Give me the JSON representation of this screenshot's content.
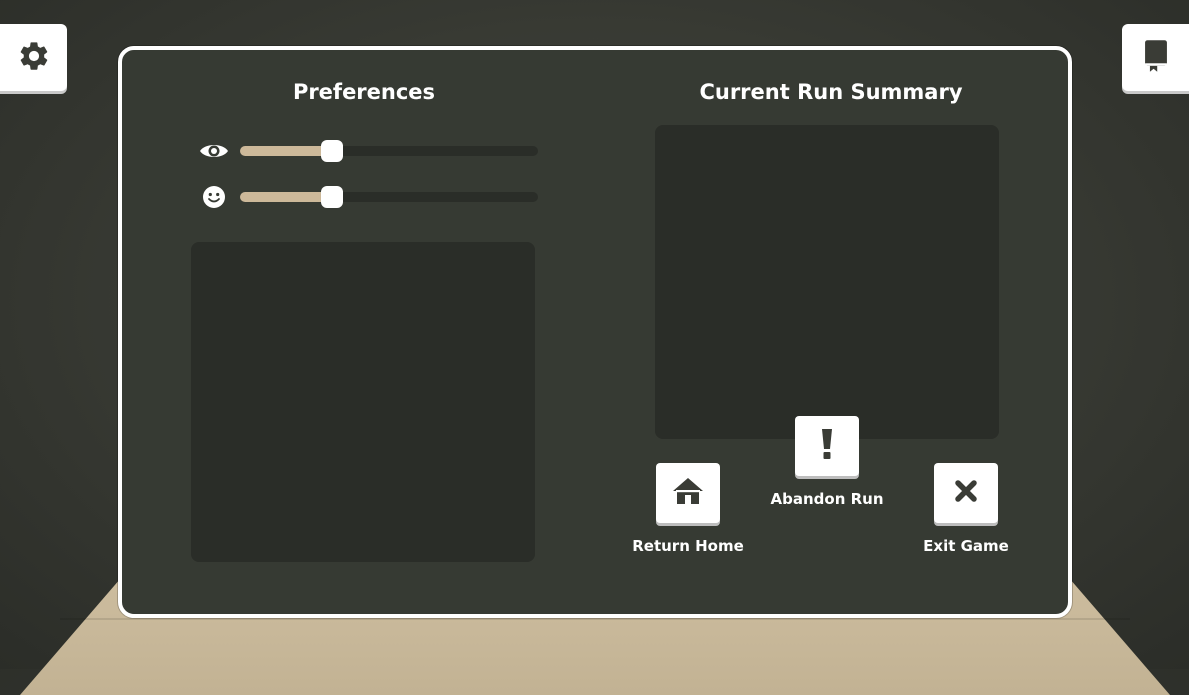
{
  "top_bar": {
    "settings_icon": "gear-icon",
    "journal_icon": "book-icon"
  },
  "preferences": {
    "title": "Preferences",
    "sliders": [
      {
        "icon": "eye-icon",
        "value": 0.31
      },
      {
        "icon": "smiley-icon",
        "value": 0.31
      }
    ]
  },
  "run_summary": {
    "title": "Current Run Summary"
  },
  "actions": {
    "return_home": {
      "label": "Return Home",
      "icon": "home-icon"
    },
    "abandon_run": {
      "label": "Abandon Run",
      "icon": "exclamation-icon"
    },
    "exit_game": {
      "label": "Exit Game",
      "icon": "close-icon"
    }
  },
  "colors": {
    "panel": "#363a33",
    "inset": "#2a2d28",
    "slider_fill": "#cdb99a",
    "text": "#ffffff"
  }
}
